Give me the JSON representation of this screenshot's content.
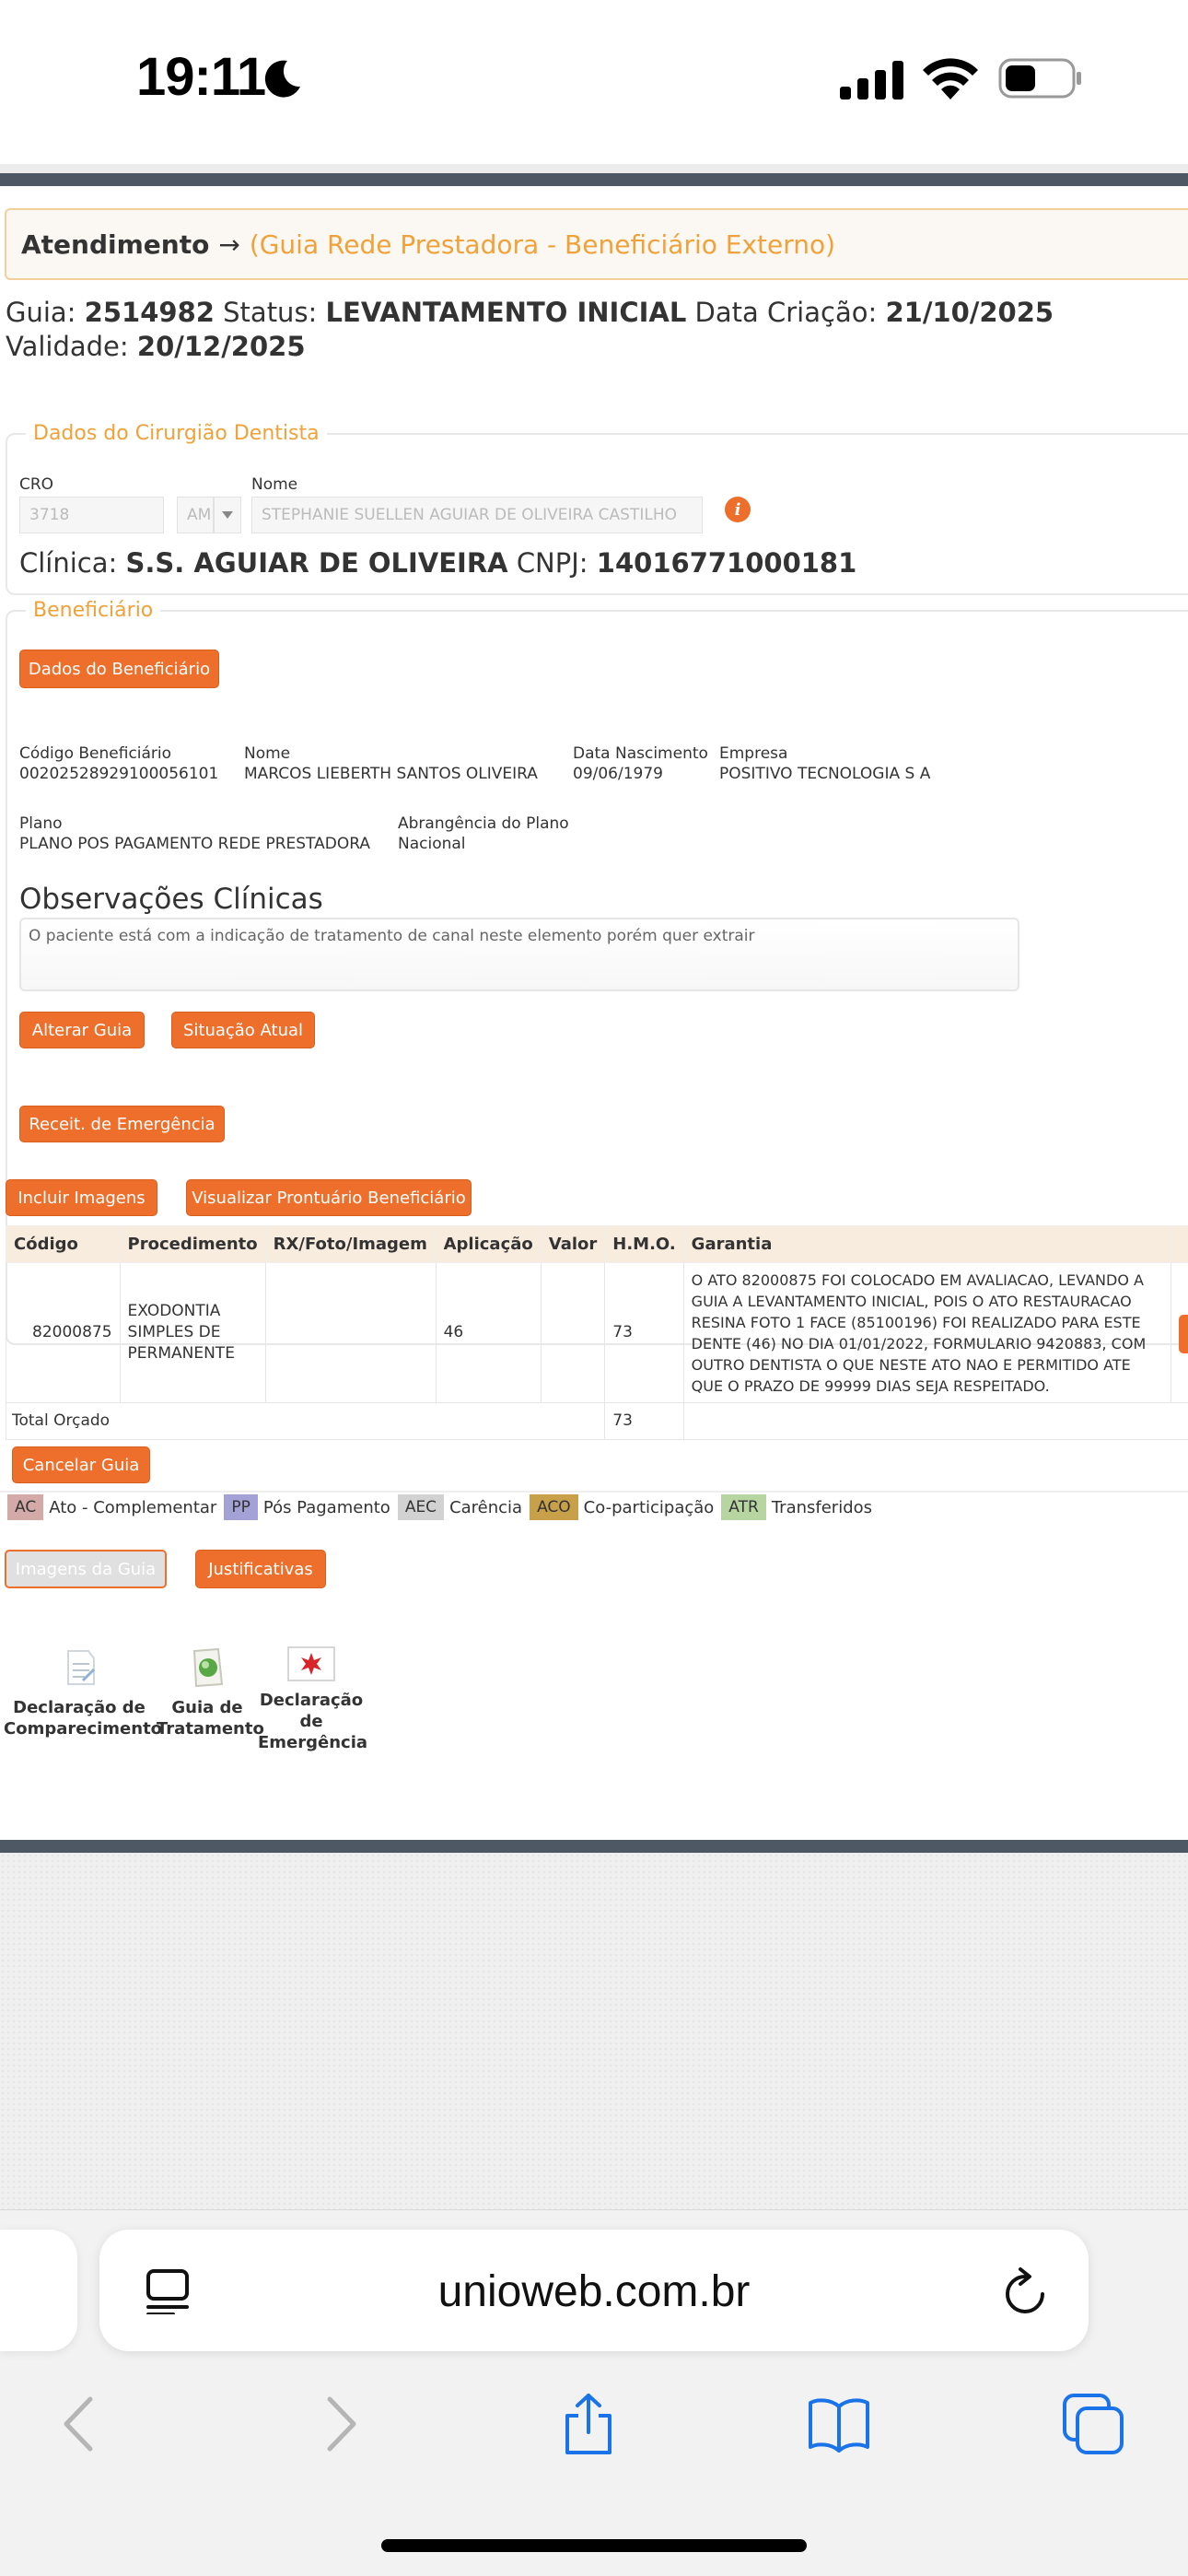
{
  "status_bar": {
    "time": "19:11"
  },
  "header": {
    "title": "Atendimento",
    "arrow": "→",
    "subtitle": "(Guia Rede Prestadora - Beneficiário Externo)"
  },
  "guia_info": {
    "guia_label": "Guia:",
    "guia_value": "2514982",
    "status_label": "Status:",
    "status_value": "LEVANTAMENTO INICIAL",
    "criacao_label": "Data Criação:",
    "criacao_value": "21/10/2025",
    "validade_label": "Validade:",
    "validade_value": "20/12/2025"
  },
  "dentista": {
    "legend": "Dados do Cirurgião Dentista",
    "cro_label": "CRO",
    "cro_value": "3718",
    "uf_value": "AM",
    "nome_label": "Nome",
    "nome_value": "STEPHANIE SUELLEN AGUIAR DE OLIVEIRA CASTILHO",
    "clinica_label": "Clínica:",
    "clinica_value": "S.S. AGUIAR DE OLIVEIRA",
    "cnpj_label": "CNPJ:",
    "cnpj_value": "14016771000181"
  },
  "beneficiario": {
    "legend": "Beneficiário",
    "dados_button": "Dados do Beneficiário",
    "codigo_label": "Código Beneficiário",
    "codigo_value": "00202528929100056101",
    "nome_label": "Nome",
    "nome_value": "MARCOS LIEBERTH SANTOS OLIVEIRA",
    "nasc_label": "Data Nascimento",
    "nasc_value": "09/06/1979",
    "empresa_label": "Empresa",
    "empresa_value": "POSITIVO TECNOLOGIA S A",
    "plano_label": "Plano",
    "plano_value": "PLANO POS PAGAMENTO REDE PRESTADORA",
    "abrangencia_label": "Abrangência do Plano",
    "abrangencia_value": "Nacional",
    "obs_title": "Observações Clínicas",
    "obs_text": "O paciente está com a indicação de tratamento de canal neste elemento porém quer extrair",
    "alterar_button": "Alterar Guia",
    "situacao_button": "Situação Atual",
    "receit_button": "Receit. de Emergência"
  },
  "actions": {
    "incluir_imagens": "Incluir Imagens",
    "visualizar_prontuario": "Visualizar Prontuário Beneficiário"
  },
  "table": {
    "headers": [
      "Código",
      "Procedimento",
      "RX/Foto/Imagem",
      "Aplicação",
      "Valor",
      "H.M.O.",
      "Garantia"
    ],
    "row": {
      "codigo": "82000875",
      "procedimento": "EXODONTIA SIMPLES DE PERMANENTE",
      "rx": "",
      "aplicacao": "46",
      "valor": "",
      "hmo": "73",
      "garantia": "O ATO 82000875 FOI COLOCADO EM AVALIACAO, LEVANDO A GUIA A LEVANTAMENTO INICIAL, POIS O ATO RESTAURACAO RESINA FOTO 1 FACE (85100196) FOI REALIZADO PARA ESTE DENTE (46) NO DIA 01/01/2022, FORMULARIO 9420883, COM OUTRO DENTISTA O QUE NESTE ATO NAO E PERMITIDO ATE QUE O PRAZO DE 99999 DIAS SEJA RESPEITADO."
    },
    "total_label": "Total Orçado",
    "total_hmo": "73"
  },
  "cancelar_button": "Cancelar Guia",
  "legend": [
    {
      "code": "AC",
      "label": "Ato - Complementar",
      "color": "#d3aaa8"
    },
    {
      "code": "PP",
      "label": "Pós Pagamento",
      "color": "#a4a1d6"
    },
    {
      "code": "AEC",
      "label": "Carência",
      "color": "#d2d2d2"
    },
    {
      "code": "ACO",
      "label": "Co-participação",
      "color": "#c9a04a"
    },
    {
      "code": "ATR",
      "label": "Transferidos",
      "color": "#b6d5a0"
    }
  ],
  "imagens_guia_button": "Imagens da Guia",
  "justificativas_button": "Justificativas",
  "documents": {
    "comparecimento_line1": "Declaração de",
    "comparecimento_line2": "Comparecimento",
    "tratamento_line1": "Guia de",
    "tratamento_line2": "Tratamento",
    "emergencia_line1": "Declaração",
    "emergencia_line2": "de",
    "emergencia_line3": "Emergência"
  },
  "browser": {
    "url": "unioweb.com.br"
  },
  "icons": [
    "moon-icon",
    "signal-icon",
    "wifi-icon",
    "battery-icon",
    "info-icon",
    "document-icon",
    "guide-icon",
    "emergency-icon",
    "reader-icon",
    "reload-icon",
    "back-icon",
    "forward-icon",
    "share-icon",
    "bookmarks-icon",
    "tabs-icon"
  ]
}
